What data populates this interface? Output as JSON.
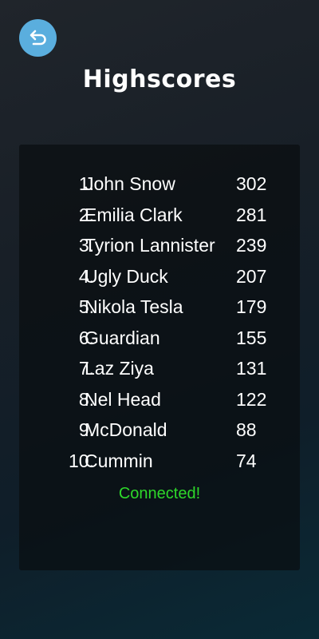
{
  "header": {
    "back_icon": "undo-arrow-icon",
    "title": "Highscores"
  },
  "scoreboard": {
    "entries": [
      {
        "rank": "1.",
        "name": "John Snow",
        "score": "302"
      },
      {
        "rank": "2.",
        "name": "Emilia Clark",
        "score": "281"
      },
      {
        "rank": "3.",
        "name": "Tyrion Lannister",
        "score": "239"
      },
      {
        "rank": "4.",
        "name": "Ugly Duck",
        "score": "207"
      },
      {
        "rank": "5.",
        "name": "Nikola Tesla",
        "score": "179"
      },
      {
        "rank": "6.",
        "name": "Guardian",
        "score": "155"
      },
      {
        "rank": "7.",
        "name": "Laz Ziya",
        "score": "131"
      },
      {
        "rank": "8.",
        "name": "Nel Head",
        "score": "122"
      },
      {
        "rank": "9.",
        "name": "McDonald",
        "score": "88"
      },
      {
        "rank": "10.",
        "name": "Cummin",
        "score": "74"
      }
    ],
    "status": "Connected!"
  },
  "colors": {
    "accent": "#5aaede",
    "status": "#2ed92a"
  }
}
